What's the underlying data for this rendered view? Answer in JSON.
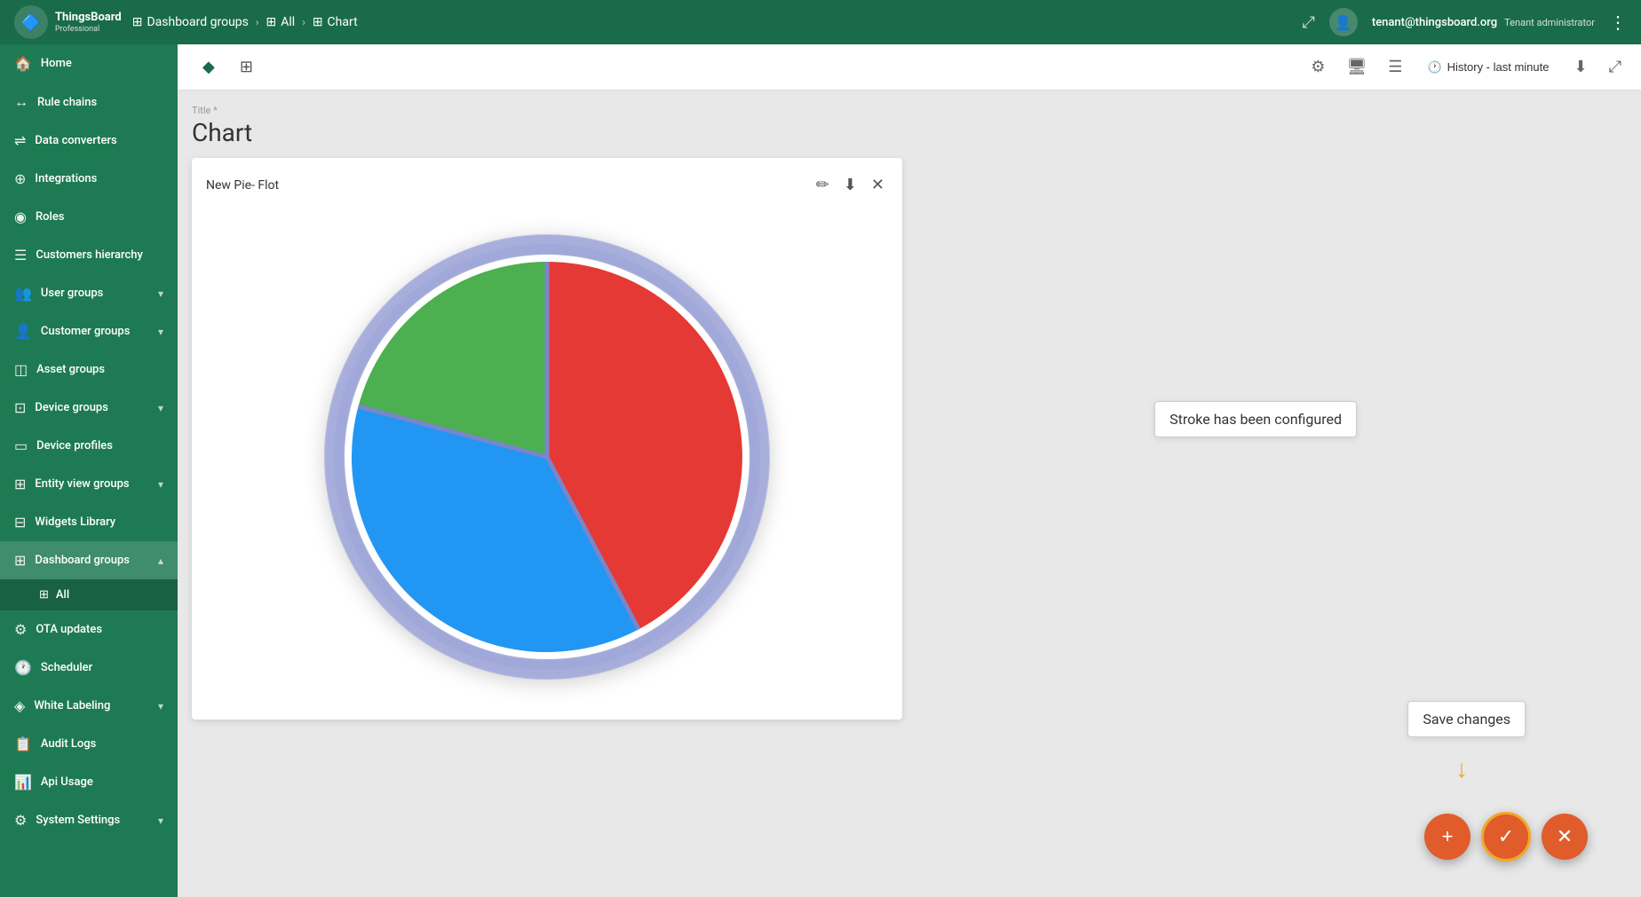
{
  "topbar": {
    "logo_text": "ThingsBoard",
    "logo_sub": "Professional",
    "breadcrumb": [
      {
        "label": "Dashboard groups",
        "icon": "⊞"
      },
      {
        "label": "All",
        "icon": "⊞"
      },
      {
        "label": "Chart",
        "icon": "⊞"
      }
    ],
    "user_email": "tenant@thingsboard.org",
    "user_role": "Tenant administrator"
  },
  "sidebar": {
    "items": [
      {
        "id": "home",
        "label": "Home",
        "icon": "🏠",
        "expandable": false
      },
      {
        "id": "rule-chains",
        "label": "Rule chains",
        "icon": "→",
        "expandable": false
      },
      {
        "id": "data-converters",
        "label": "Data converters",
        "icon": "⇌",
        "expandable": false
      },
      {
        "id": "integrations",
        "label": "Integrations",
        "icon": "⊕",
        "expandable": false
      },
      {
        "id": "roles",
        "label": "Roles",
        "icon": "⊙",
        "expandable": false
      },
      {
        "id": "customers-hierarchy",
        "label": "Customers hierarchy",
        "icon": "☰",
        "expandable": false
      },
      {
        "id": "user-groups",
        "label": "User groups",
        "icon": "👥",
        "expandable": true
      },
      {
        "id": "customer-groups",
        "label": "Customer groups",
        "icon": "👤",
        "expandable": true
      },
      {
        "id": "asset-groups",
        "label": "Asset groups",
        "icon": "◫",
        "expandable": false
      },
      {
        "id": "device-groups",
        "label": "Device groups",
        "icon": "⊡",
        "expandable": true
      },
      {
        "id": "device-profiles",
        "label": "Device profiles",
        "icon": "▭",
        "expandable": false
      },
      {
        "id": "entity-view-groups",
        "label": "Entity view groups",
        "icon": "⊞",
        "expandable": true
      },
      {
        "id": "widgets-library",
        "label": "Widgets Library",
        "icon": "⊟",
        "expandable": false
      },
      {
        "id": "dashboard-groups",
        "label": "Dashboard groups",
        "icon": "⊞",
        "expandable": true,
        "active": true
      },
      {
        "id": "ota-updates",
        "label": "OTA updates",
        "icon": "⚙",
        "expandable": false
      },
      {
        "id": "scheduler",
        "label": "Scheduler",
        "icon": "🕐",
        "expandable": false
      },
      {
        "id": "white-labeling",
        "label": "White Labeling",
        "icon": "◈",
        "expandable": true
      },
      {
        "id": "audit-logs",
        "label": "Audit Logs",
        "icon": "📋",
        "expandable": false
      },
      {
        "id": "api-usage",
        "label": "Api Usage",
        "icon": "⊿",
        "expandable": false
      },
      {
        "id": "system-settings",
        "label": "System Settings",
        "icon": "⚙",
        "expandable": true
      }
    ],
    "sub_items": [
      {
        "id": "all",
        "label": "All",
        "icon": "⊞",
        "active": true
      }
    ]
  },
  "sub_header": {
    "tab_diamond": "◆",
    "tab_grid": "⊞",
    "history_label": "History - last minute"
  },
  "dashboard": {
    "title_label": "Title *",
    "title": "Chart",
    "widget": {
      "name": "New Pie- Flot",
      "pie_segments": [
        {
          "label": "Red",
          "color": "#e53935",
          "startAngle": -90,
          "endAngle": 90
        },
        {
          "label": "Blue",
          "color": "#2196F3",
          "startAngle": -90,
          "endAngle": 90
        },
        {
          "label": "Green",
          "color": "#4CAF50",
          "startAngle": 90,
          "endAngle": 210
        }
      ]
    }
  },
  "tooltips": {
    "stroke": "Stroke has been configured",
    "save": "Save changes"
  },
  "fab": {
    "add_label": "+",
    "confirm_label": "✓",
    "cancel_label": "✕"
  }
}
